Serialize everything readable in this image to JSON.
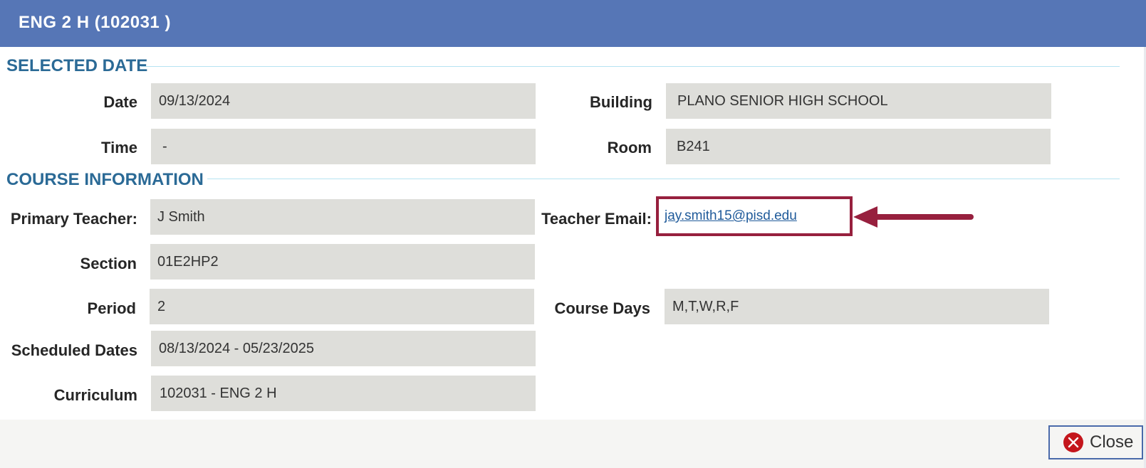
{
  "dialog": {
    "title": "ENG 2 H (102031 )"
  },
  "selected_date": {
    "heading": "SELECTED DATE",
    "date": {
      "label": "Date",
      "value": "09/13/2024"
    },
    "time": {
      "label": "Time",
      "value": "-"
    },
    "building": {
      "label": "Building",
      "value": "PLANO SENIOR HIGH SCHOOL"
    },
    "room": {
      "label": "Room",
      "value": "B241"
    }
  },
  "course_information": {
    "heading": "COURSE INFORMATION",
    "primary_teacher": {
      "label": "Primary Teacher:",
      "value": "J Smith"
    },
    "teacher_email": {
      "label": "Teacher Email:",
      "value": "jay.smith15@pisd.edu"
    },
    "section": {
      "label": "Section",
      "value": "01E2HP2"
    },
    "period": {
      "label": "Period",
      "value": "2"
    },
    "course_days": {
      "label": "Course Days",
      "value": "M,T,W,R,F"
    },
    "scheduled_dates": {
      "label": "Scheduled Dates",
      "value": "08/13/2024 - 05/23/2025"
    },
    "curriculum": {
      "label": "Curriculum",
      "value": "102031 - ENG 2 H"
    }
  },
  "footer": {
    "close_label": "Close"
  },
  "colors": {
    "titlebar": "#5676b6",
    "heading": "#2b6a96",
    "field_bg": "#dededa",
    "highlight": "#97203e",
    "link": "#1f5a9a",
    "close_icon": "#c4161c"
  },
  "icons": {
    "close": "close-circle-icon",
    "annotation": "arrow-left-icon"
  }
}
